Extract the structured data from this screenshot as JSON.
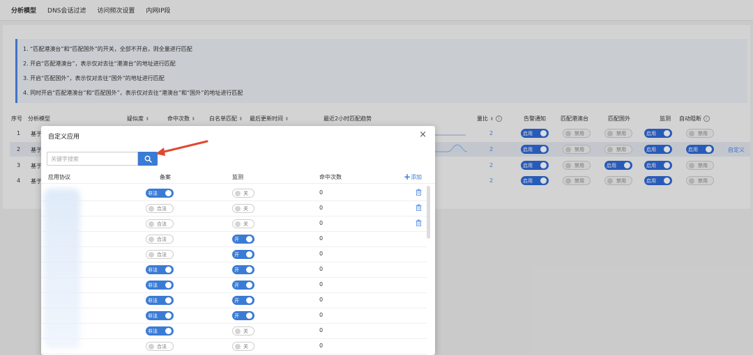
{
  "topnav": {
    "tabs": [
      "分析模型",
      "DNS会话过滤",
      "访问频次设置",
      "内网IP段"
    ]
  },
  "notice": {
    "lines": [
      "1. “匹配港澳台”和“匹配国外”的开关，全部不开启，则全量进行匹配",
      "2. 开启“匹配港澳台”，表示仅对去往“港澳台”的地址进行匹配",
      "3. 开启“匹配国外”，表示仅对去往“国外”的地址进行匹配",
      "4. 同时开启“匹配港澳台”和“匹配国外”，表示仅对去往“港澳台”和“国外”的地址进行匹配"
    ]
  },
  "bg_table": {
    "headers": {
      "seq": "序号",
      "model": "分析模型",
      "suspicion": "疑似度",
      "hits": "命中次数",
      "whitelist": "白名单匹配",
      "updated": "最后更新时间",
      "trend": "最近2小时匹配趋势",
      "ratio": "量比",
      "alert": "告警通知",
      "hk": "匹配港澳台",
      "foreign": "匹配国外",
      "monitor": "监测",
      "autoblock": "自动阻断"
    },
    "rows": [
      {
        "seq": "1",
        "name": "基于",
        "ratio": "2",
        "alert": "启用",
        "hk": "禁用",
        "foreign": "禁用",
        "monitor": "启用",
        "block": "禁用",
        "custom": ""
      },
      {
        "seq": "2",
        "name": "基于",
        "ratio": "2",
        "alert": "启用",
        "hk": "禁用",
        "foreign": "禁用",
        "monitor": "启用",
        "block": "启用",
        "custom": "自定义"
      },
      {
        "seq": "3",
        "name": "基于",
        "ratio": "2",
        "alert": "启用",
        "hk": "禁用",
        "foreign": "启用",
        "monitor": "启用",
        "block": "禁用",
        "custom": ""
      },
      {
        "seq": "4",
        "name": "基于",
        "ratio": "2",
        "alert": "启用",
        "hk": "禁用",
        "foreign": "禁用",
        "monitor": "启用",
        "block": "禁用",
        "custom": ""
      }
    ]
  },
  "modal": {
    "title": "自定义应用",
    "close": "×",
    "search_placeholder": "关键字搜索",
    "headers": {
      "protocol": "应用协议",
      "filing": "备案",
      "monitor": "监测",
      "hits": "命中次数",
      "add": "添加"
    },
    "rows": [
      {
        "filing": "非法",
        "filing_on": true,
        "monitor": "关",
        "monitor_on": false,
        "hits": "0",
        "deletable": true
      },
      {
        "filing": "合法",
        "filing_on": false,
        "monitor": "关",
        "monitor_on": false,
        "hits": "0",
        "deletable": true
      },
      {
        "filing": "合法",
        "filing_on": false,
        "monitor": "关",
        "monitor_on": false,
        "hits": "0",
        "deletable": true
      },
      {
        "filing": "合法",
        "filing_on": false,
        "monitor": "开",
        "monitor_on": true,
        "hits": "0",
        "deletable": false
      },
      {
        "filing": "合法",
        "filing_on": false,
        "monitor": "开",
        "monitor_on": true,
        "hits": "0",
        "deletable": false
      },
      {
        "filing": "非法",
        "filing_on": true,
        "monitor": "开",
        "monitor_on": true,
        "hits": "0",
        "deletable": false
      },
      {
        "filing": "非法",
        "filing_on": true,
        "monitor": "开",
        "monitor_on": true,
        "hits": "0",
        "deletable": false
      },
      {
        "filing": "非法",
        "filing_on": true,
        "monitor": "开",
        "monitor_on": true,
        "hits": "0",
        "deletable": false
      },
      {
        "filing": "非法",
        "filing_on": true,
        "monitor": "开",
        "monitor_on": true,
        "hits": "0",
        "deletable": false
      },
      {
        "filing": "非法",
        "filing_on": true,
        "monitor": "关",
        "monitor_on": false,
        "hits": "0",
        "deletable": false
      },
      {
        "filing": "合法",
        "filing_on": false,
        "monitor": "关",
        "monitor_on": false,
        "hits": "0",
        "deletable": false
      }
    ]
  },
  "colors": {
    "accent": "#3a7bd5",
    "arrow": "#e0482f"
  }
}
